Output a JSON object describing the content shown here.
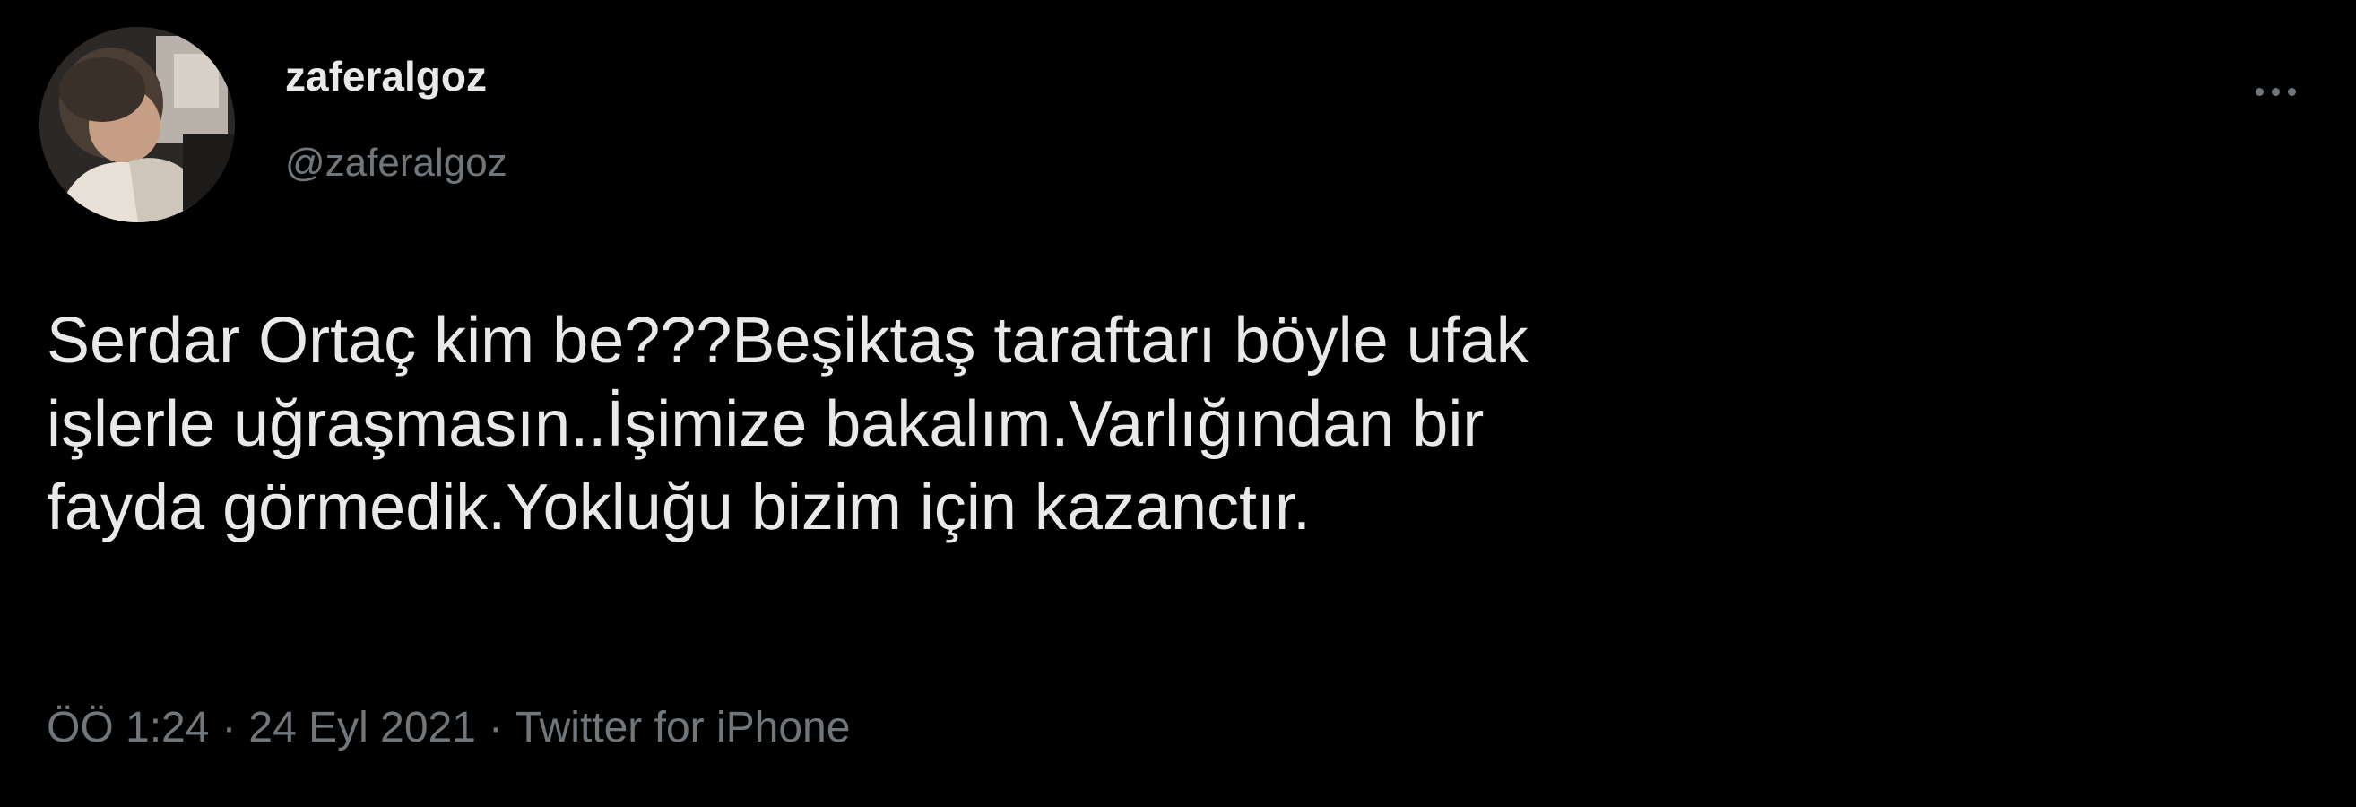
{
  "tweet": {
    "author": {
      "display_name": "zaferalgoz",
      "handle": "@zaferalgoz"
    },
    "text": "Serdar Ortaç kim be???Beşiktaş taraftarı böyle ufak\nişlerle uğraşmasın..İşimize bakalım.Varlığından bir\nfayda görmedik.Yokluğu bizim için kazanctır.",
    "meta": {
      "time": "ÖÖ 1:24",
      "separator": "·",
      "date": "24 Eyl 2021",
      "source": "Twitter for iPhone"
    },
    "icons": {
      "more": "more-horizontal-icon"
    }
  },
  "colors": {
    "background": "#000000",
    "primary_text": "#e7e9ea",
    "secondary_text": "#71767b"
  }
}
